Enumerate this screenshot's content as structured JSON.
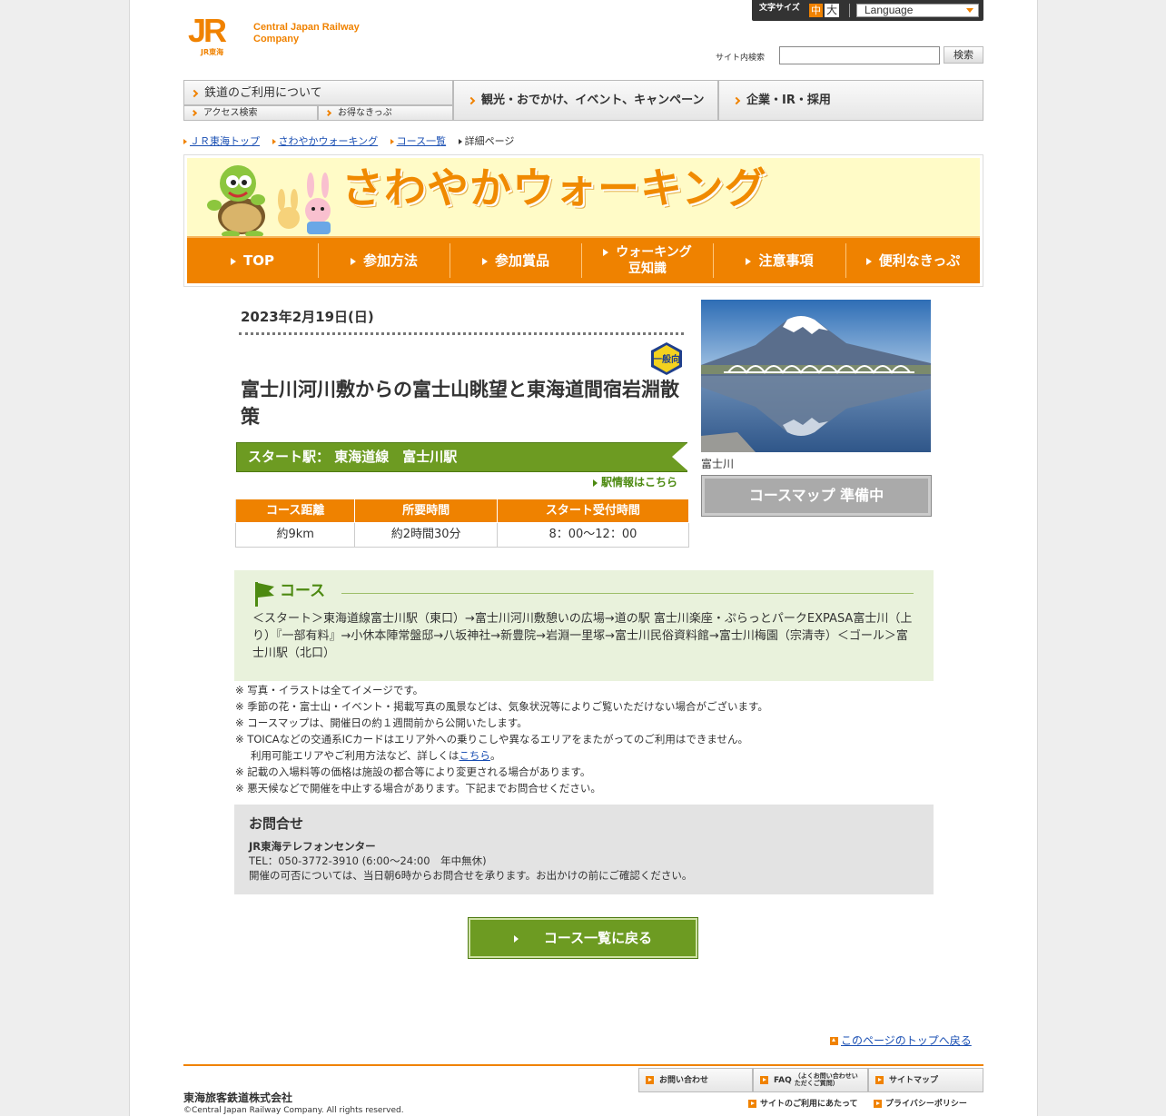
{
  "header": {
    "logo_text": "JR",
    "logo_sub": "JR東海",
    "company_en": "Central Japan Railway Company",
    "font_size_label": "文字サイズ",
    "font_mid": "中",
    "font_large": "大",
    "language": "Language",
    "search_label": "サイト内検索",
    "search_value": "",
    "search_button": "検索"
  },
  "gnav": {
    "rail": "鉄道のご利用について",
    "access": "アクセス検索",
    "tickets": "お得なきっぷ",
    "tourism": "観光・おでかけ、イベント、キャンペーン",
    "corporate": "企業・IR・採用"
  },
  "breadcrumb": [
    "ＪＲ東海トップ",
    "さわやかウォーキング",
    "コース一覧",
    "詳細ページ"
  ],
  "banner": {
    "title": "さわやかウォーキング",
    "nav": [
      "TOP",
      "参加方法",
      "参加賞品",
      "ウォーキング",
      "豆知識",
      "注意事項",
      "便利なきっぷ"
    ]
  },
  "event": {
    "date": "2023年2月19日(日)",
    "badge": "一般向",
    "title": "富士川河川敷からの富士山眺望と東海道間宿岩淵散策",
    "start_station": "スタート駅： 東海道線　富士川駅",
    "station_info": "駅情報はこちら",
    "table_headers": [
      "コース距離",
      "所要時間",
      "スタート受付時間"
    ],
    "table_values": [
      "約9km",
      "約2時間30分",
      "8：00～12：00"
    ],
    "photo_caption": "富士川",
    "map_button": "コースマップ 準備中"
  },
  "course": {
    "heading": "コース",
    "description": "＜スタート＞東海道線富士川駅（東口）→富士川河川敷憩いの広場→道の駅 富士川楽座・ぷらっとパークEXPASA富士川（上り）『一部有料』→小休本陣常盤邸→八坂神社→新豊院→岩淵一里塚→富士川民俗資料館→富士川梅園（宗清寺）＜ゴール＞富士川駅（北口）"
  },
  "notes": {
    "n1": "※ 写真・イラストは全てイメージです。",
    "n2": "※ 季節の花・富士山・イベント・掲載写真の風景などは、気象状況等によりご覧いただけない場合がございます。",
    "n3": "※ コースマップは、開催日の約１週間前から公開いたします。",
    "n4": "※ TOICAなどの交通系ICカードはエリア外への乗りこしや異なるエリアをまたがってのご利用はできません。",
    "n4b_pre": "利用可能エリアやご利用方法など、詳しくは",
    "n4b_link": "こちら",
    "n4b_post": "。",
    "n5": "※ 記載の入場料等の価格は施設の都合等により変更される場合があります。",
    "n6": "※ 悪天候などで開催を中止する場合があります。下記までお問合せください。"
  },
  "contact": {
    "heading": "お問合せ",
    "name": "JR東海テレフォンセンター",
    "tel": "TEL：050-3772-3910 (6:00～24:00　年中無休)",
    "note": "開催の可否については、当日朝6時からお問合せを承ります。お出かけの前にご確認ください。"
  },
  "back_button": "コース一覧に戻る",
  "page_top": "このページのトップへ戻る",
  "footer": {
    "company": "東海旅客鉄道株式会社",
    "copyright": "©Central Japan Railway Company. All rights reserved.",
    "contact": "お問い合わせ",
    "faq": "FAQ",
    "faq_sub": "（よくお問い合わせいただくご質問）",
    "sitemap": "サイトマップ",
    "terms": "サイトのご利用にあたって",
    "privacy": "プライバシーポリシー"
  },
  "colors": {
    "accent": "#f08200",
    "green": "#6d9b22",
    "banner_bg": "#fffbc7"
  }
}
